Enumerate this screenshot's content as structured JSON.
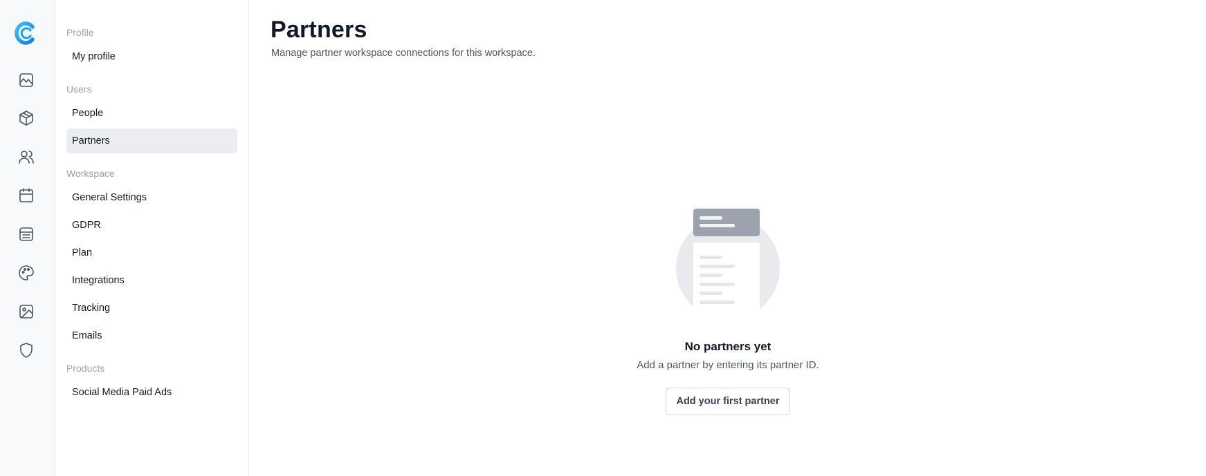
{
  "rail": {
    "icons": [
      "app-logo",
      "chart-icon",
      "package-icon",
      "users-icon",
      "calendar-icon",
      "list-icon",
      "palette-icon",
      "image-icon",
      "shield-icon"
    ],
    "logo_color": "#1d9bf0"
  },
  "subnav": {
    "sections": [
      {
        "label": "Profile",
        "items": [
          "My profile"
        ]
      },
      {
        "label": "Users",
        "items": [
          "People",
          "Partners"
        ]
      },
      {
        "label": "Workspace",
        "items": [
          "General Settings",
          "GDPR",
          "Plan",
          "Integrations",
          "Tracking",
          "Emails"
        ]
      },
      {
        "label": "Products",
        "items": [
          "Social Media Paid Ads"
        ]
      }
    ],
    "active_item": "Partners"
  },
  "main": {
    "title": "Partners",
    "subtitle": "Manage partner workspace connections for this workspace.",
    "empty_state": {
      "title": "No partners yet",
      "description": "Add a partner by entering its partner ID.",
      "button_label": "Add your first partner"
    }
  },
  "colors": {
    "active_bg": "#ebedf0",
    "section_label": "#9ca3af",
    "illustration_circle": "#e9eaee",
    "illustration_header": "#9ca3af"
  }
}
